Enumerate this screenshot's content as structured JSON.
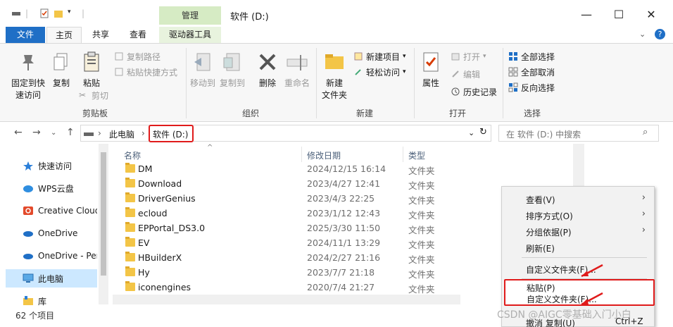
{
  "window": {
    "title": "软件 (D:)",
    "context_tab_header": "管理"
  },
  "tabs": [
    {
      "label": "文件"
    },
    {
      "label": "主页"
    },
    {
      "label": "共享"
    },
    {
      "label": "查看"
    },
    {
      "label": "驱动器工具"
    }
  ],
  "ribbon": {
    "clipboard": {
      "pin_label": "固定到快速访问",
      "pin_line1": "固定到快",
      "pin_line2": "速访问",
      "copy_label": "复制",
      "paste_label": "粘贴",
      "copy_path": "复制路径",
      "paste_shortcut": "粘贴快捷方式",
      "cut": "剪切",
      "group": "剪贴板"
    },
    "organize": {
      "move_to": "移动到",
      "copy_to": "复制到",
      "delete": "删除",
      "rename": "重命名",
      "group": "组织"
    },
    "new": {
      "new_folder_line1": "新建",
      "new_folder_line2": "文件夹",
      "new_item": "新建项目",
      "easy_access": "轻松访问",
      "group": "新建"
    },
    "open": {
      "properties": "属性",
      "open": "打开",
      "edit": "编辑",
      "history": "历史记录",
      "group": "打开"
    },
    "select": {
      "select_all": "全部选择",
      "select_none": "全部取消",
      "invert": "反向选择",
      "group": "选择"
    }
  },
  "address": {
    "this_pc": "此电脑",
    "current": "软件 (D:)",
    "search_placeholder": "在 软件 (D:) 中搜索"
  },
  "nav_pane": [
    {
      "label": "快速访问"
    },
    {
      "label": "WPS云盘"
    },
    {
      "label": "Creative Cloud"
    },
    {
      "label": "OneDrive"
    },
    {
      "label": "OneDrive - Per"
    },
    {
      "label": "此电脑"
    },
    {
      "label": "库"
    }
  ],
  "columns": {
    "name": "名称",
    "modified": "修改日期",
    "type": "类型"
  },
  "files": [
    {
      "name": "DM",
      "date": "2024/12/15 16:14",
      "type": "文件夹"
    },
    {
      "name": "Download",
      "date": "2023/4/27 12:41",
      "type": "文件夹"
    },
    {
      "name": "DriverGenius",
      "date": "2023/4/3 22:25",
      "type": "文件夹"
    },
    {
      "name": "ecloud",
      "date": "2023/1/12 12:43",
      "type": "文件夹"
    },
    {
      "name": "EPPortal_DS3.0",
      "date": "2025/3/30 11:50",
      "type": "文件夹"
    },
    {
      "name": "EV",
      "date": "2024/11/1 13:29",
      "type": "文件夹"
    },
    {
      "name": "HBuilderX",
      "date": "2024/2/27 21:16",
      "type": "文件夹"
    },
    {
      "name": "Hy",
      "date": "2023/7/7 21:18",
      "type": "文件夹"
    },
    {
      "name": "iconengines",
      "date": "2020/7/4 21:27",
      "type": "文件夹"
    }
  ],
  "status": {
    "count": "62 个项目"
  },
  "context_menu": {
    "view": "查看(V)",
    "sort": "排序方式(O)",
    "group": "分组依据(P)",
    "refresh": "刷新(E)",
    "customize": "自定义文件夹(F)...",
    "paste": "粘贴(P)",
    "customize_dup": "自定义文件夹(F)...",
    "undo_copy": "撤消 复制(U)",
    "undo_shortcut": "Ctrl+Z"
  },
  "watermark": "CSDN @AIGC零基础入门小白",
  "colors": {
    "file_tab": "#1f6fc6",
    "context_tab": "#d6ebc4",
    "selection": "#cce8ff",
    "highlight_red": "#e01b1b",
    "folder": "#f3c547"
  }
}
